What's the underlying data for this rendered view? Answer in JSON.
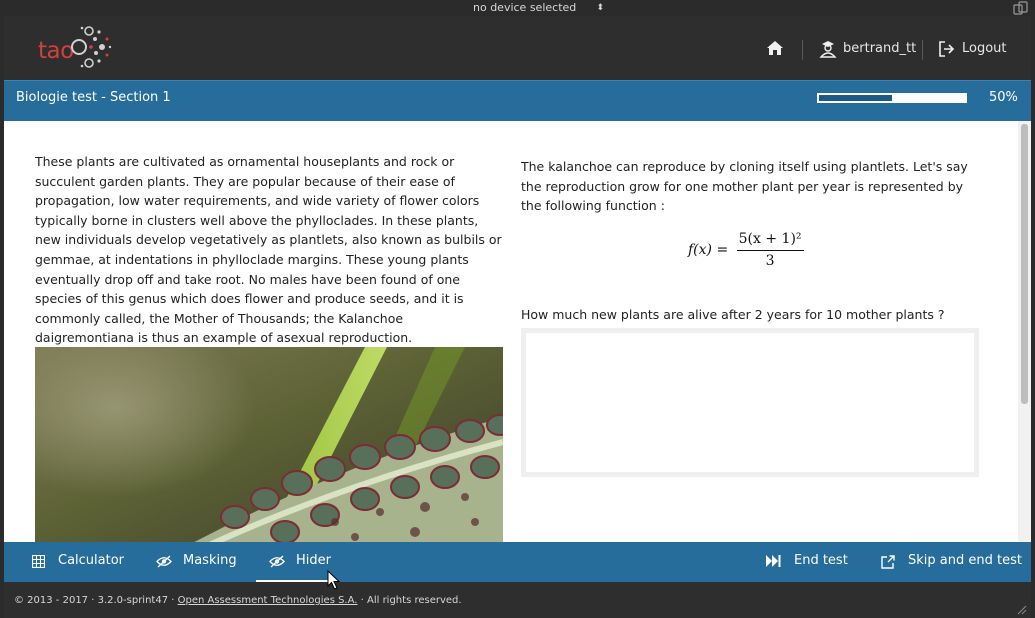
{
  "device_bar": {
    "selected": "no device selected"
  },
  "header": {
    "logo_text": "tao",
    "user_label": "bertrand_tt",
    "logout_label": "Logout"
  },
  "titlebar": {
    "title": "Biologie test - Section 1",
    "progress_label": "50%",
    "progress_fraction": 0.5
  },
  "content": {
    "passage": "These plants are cultivated as ornamental houseplants and rock or succulent garden plants. They are popular because of their ease of propagation, low water requirements, and wide variety of flower colors typically borne in clusters well above the phylloclades. In these plants, new individuals develop vegetatively as plantlets, also known as bulbils or gemmae, at indentations in phylloclade margins. These young plants eventually drop off and take root. No males have been found of one species of this genus which does flower and produce seeds, and it is commonly called, the Mother of Thousands; the Kalanchoe daigremontiana is thus an example of asexual reproduction.",
    "question_intro": "The kalanchoe can reproduce by cloning itself using plantlets.  Let's say the reproduction grow for one mother plant per year is represented by the following function :",
    "formula_lhs": "f(x) =",
    "formula_numerator": "5(x + 1)²",
    "formula_denominator": "3",
    "prompt": "How much new plants are alive after 2 years for 10 mother plants ?"
  },
  "toolbar": {
    "calculator": "Calculator",
    "masking": "Masking",
    "hider": "Hider",
    "end_test": "End test",
    "skip_end": "Skip and end test"
  },
  "footer": {
    "copyright_prefix": "© 2013 - 2017 · 3.2.0-sprint47 ·",
    "company": "Open Assessment Technologies S.A.",
    "copyright_suffix": "· All rights reserved."
  },
  "colors": {
    "brand_blue": "#266d9c",
    "header_bg": "#2e2e2e",
    "logo_red": "#d0423c"
  }
}
